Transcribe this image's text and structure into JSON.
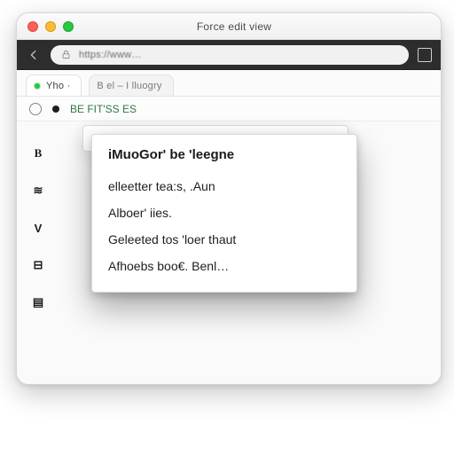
{
  "window": {
    "title": "Force edit view"
  },
  "titlebar": {
    "close": "close",
    "min": "minimize",
    "max": "maximize"
  },
  "toolbar": {
    "back": "back",
    "url": "https://www…"
  },
  "tabs": [
    {
      "label": "Yho ·",
      "active": true
    },
    {
      "label": "B el – I lluogry",
      "active": false
    }
  ],
  "strip2": {
    "link": "BE FIT'SS ES"
  },
  "sidebar": {
    "glyphs": [
      "B",
      "≋",
      "V",
      "⊟",
      "▤"
    ]
  },
  "dropdown": {
    "section_title": "iMuoGor' be  'leegne",
    "items": [
      "elleetter tea:s,  .Aun",
      "Alboer' iies.",
      "Geleeted  tos 'loer  thaut",
      "Afhoebs boo€. Benl…"
    ]
  }
}
